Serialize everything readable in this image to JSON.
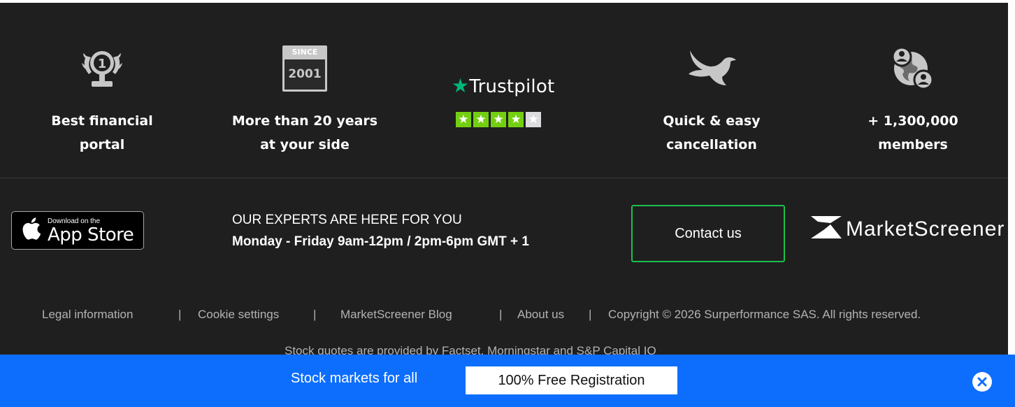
{
  "features": [
    {
      "icon": "laurel-medal-icon",
      "line1": "Best financial",
      "line2": "portal"
    },
    {
      "icon": "since-2001-badge-icon",
      "badge_top": "SINCE",
      "badge_year": "2001",
      "line1": "More than 20 years",
      "line2": "at your side"
    },
    {
      "icon": "trustpilot-logo",
      "brand": "Trustpilot",
      "rating_stars": 4,
      "max_stars": 5
    },
    {
      "icon": "dove-icon",
      "line1": "Quick & easy",
      "line2": "cancellation"
    },
    {
      "icon": "members-globe-icon",
      "line1": "+ 1,300,000",
      "line2": "members"
    }
  ],
  "app_store": {
    "small": "Download on the",
    "big": "App Store"
  },
  "experts": {
    "line1": "OUR EXPERTS ARE HERE FOR YOU",
    "line2": "Monday - Friday 9am-12pm / 2pm-6pm GMT + 1"
  },
  "contact_label": "Contact us",
  "brand_name": "MarketScreener",
  "links": {
    "legal": "Legal information",
    "sep": "|",
    "cookie": "Cookie settings",
    "blog": "MarketScreener Blog",
    "about": "About us",
    "copyright": "Copyright © 2026 Surperformance SAS. All rights reserved."
  },
  "quotes_notice": "Stock quotes are provided by Factset, Morningstar and S&P Capital IQ",
  "banner": {
    "text": "Stock markets for all",
    "button": "100% Free Registration"
  },
  "colors": {
    "background": "#1f1f1f",
    "accent_green": "#1cbf4c",
    "banner_blue": "#0d6efd",
    "trustpilot_green": "#00b67a",
    "star_green": "#73cf11"
  }
}
